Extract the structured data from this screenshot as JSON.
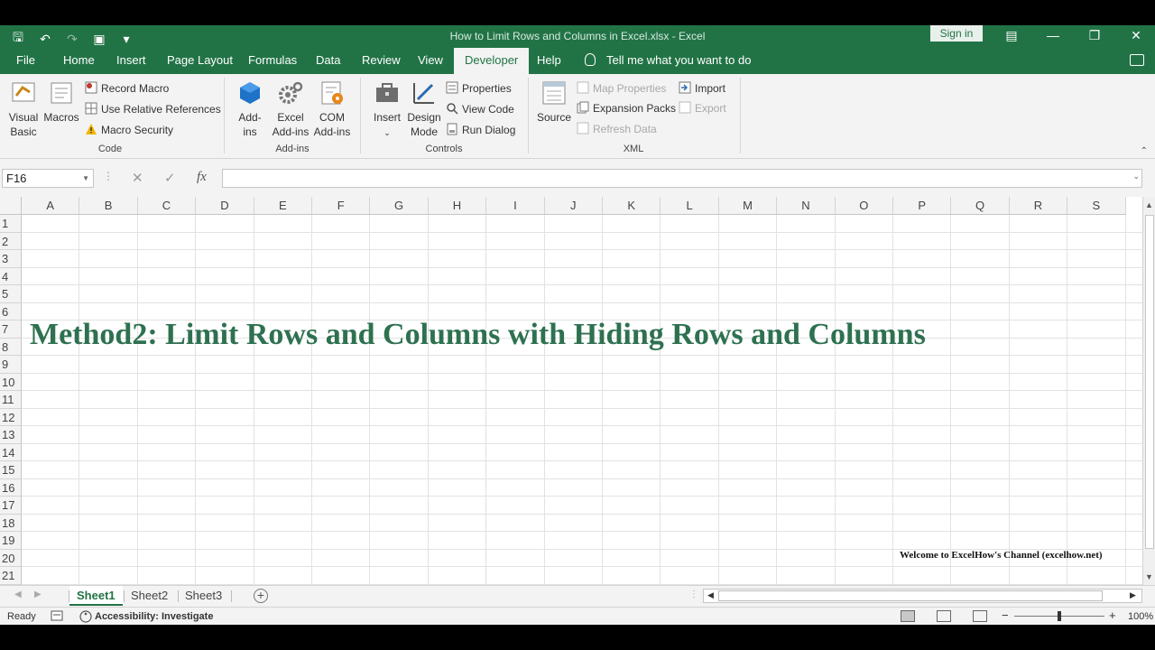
{
  "window": {
    "title": "How to Limit Rows and Columns in Excel.xlsx  -  Excel",
    "sign_in": "Sign in"
  },
  "tabs": [
    "File",
    "Home",
    "Insert",
    "Page Layout",
    "Formulas",
    "Data",
    "Review",
    "View",
    "Developer",
    "Help"
  ],
  "active_tab": "Developer",
  "tell_me": "Tell me what you want to do",
  "ribbon": {
    "code": {
      "label": "Code",
      "visual_basic": "Visual\nBasic",
      "macros": "Macros",
      "record_macro": "Record Macro",
      "use_relative": "Use Relative References",
      "macro_security": "Macro Security"
    },
    "addins": {
      "label": "Add-ins",
      "addins": "Add-\nins",
      "excel_addins": "Excel\nAdd-ins",
      "com_addins": "COM\nAdd-ins"
    },
    "controls": {
      "label": "Controls",
      "insert": "Insert",
      "design_mode": "Design\nMode",
      "properties": "Properties",
      "view_code": "View Code",
      "run_dialog": "Run Dialog"
    },
    "xml": {
      "label": "XML",
      "source": "Source",
      "map_properties": "Map Properties",
      "expansion_packs": "Expansion Packs",
      "refresh_data": "Refresh Data",
      "import": "Import",
      "export": "Export"
    }
  },
  "formula_bar": {
    "name_box": "F16",
    "fx": "fx",
    "cancel": "✕",
    "enter": "✓",
    "formula": ""
  },
  "grid": {
    "columns": [
      "A",
      "B",
      "C",
      "D",
      "E",
      "F",
      "G",
      "H",
      "I",
      "J",
      "K",
      "L",
      "M",
      "N",
      "O",
      "P",
      "Q",
      "R",
      "S"
    ],
    "rows": [
      "1",
      "2",
      "3",
      "4",
      "5",
      "6",
      "7",
      "8",
      "9",
      "10",
      "11",
      "12",
      "13",
      "14",
      "15",
      "16",
      "17",
      "18",
      "19",
      "20",
      "21"
    ]
  },
  "overlay": {
    "title": "Method2: Limit Rows and Columns with Hiding Rows and Columns",
    "footer": "Welcome to ExcelHow's  Channel (excelhow.net)"
  },
  "sheets": [
    "Sheet1",
    "Sheet2",
    "Sheet3"
  ],
  "active_sheet": "Sheet1",
  "status": {
    "ready": "Ready",
    "accessibility": "Accessibility: Investigate",
    "zoom": "100%",
    "zoom_minus": "−",
    "zoom_plus": "+"
  },
  "colors": {
    "brand": "#217346",
    "title_text": "#2e7150"
  }
}
